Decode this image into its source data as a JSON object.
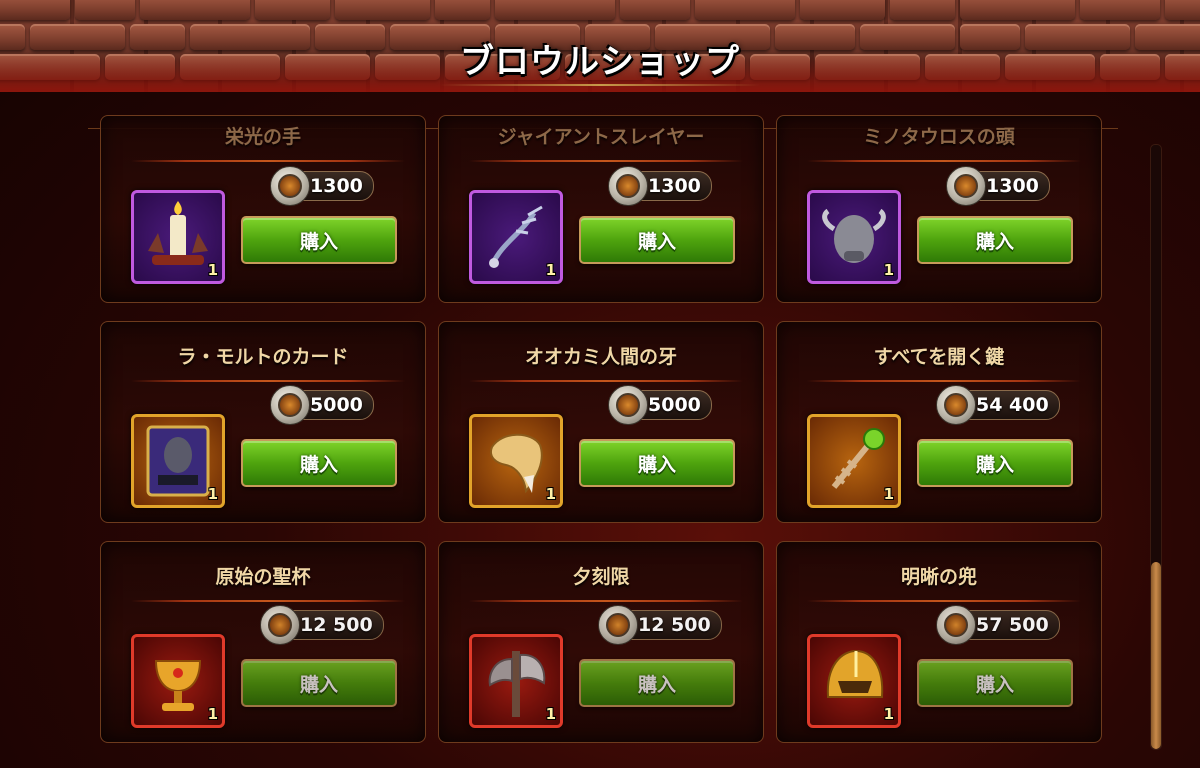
{
  "shop": {
    "title": "ブロウルショップ"
  },
  "buy_label": "購入",
  "items": [
    {
      "name": "栄光の手",
      "price": "1300",
      "qty": "1",
      "rarity": "purple",
      "icon": "candle-hand-icon",
      "row": "top"
    },
    {
      "name": "ジャイアントスレイヤー",
      "price": "1300",
      "qty": "1",
      "rarity": "purple",
      "icon": "antler-bow-icon",
      "row": "top"
    },
    {
      "name": "ミノタウロスの頭",
      "price": "1300",
      "qty": "1",
      "rarity": "purple",
      "icon": "minotaur-head-icon",
      "row": "top"
    },
    {
      "name": "ラ・モルトのカード",
      "price": "5000",
      "qty": "1",
      "rarity": "gold",
      "icon": "card-icon",
      "row": "mid"
    },
    {
      "name": "オオカミ人間の牙",
      "price": "5000",
      "qty": "1",
      "rarity": "gold",
      "icon": "fang-icon",
      "row": "mid"
    },
    {
      "name": "すべてを開く鍵",
      "price": "54 400",
      "qty": "1",
      "rarity": "gold",
      "icon": "key-icon",
      "row": "mid"
    },
    {
      "name": "原始の聖杯",
      "price": "12 500",
      "qty": "1",
      "rarity": "red",
      "icon": "grail-icon",
      "row": "bottom"
    },
    {
      "name": "夕刻限",
      "price": "12 500",
      "qty": "1",
      "rarity": "red",
      "icon": "axe-icon",
      "row": "bottom"
    },
    {
      "name": "明晰の兜",
      "price": "57 500",
      "qty": "1",
      "rarity": "red",
      "icon": "helmet-icon",
      "row": "bottom"
    }
  ],
  "colors": {
    "purple": "#c05ae0",
    "gold": "#e2a42a",
    "red": "#e03a2a",
    "buy_button": "#4fa40e"
  },
  "scroll": {
    "position_fraction": 0.69,
    "visible_fraction": 0.31
  }
}
